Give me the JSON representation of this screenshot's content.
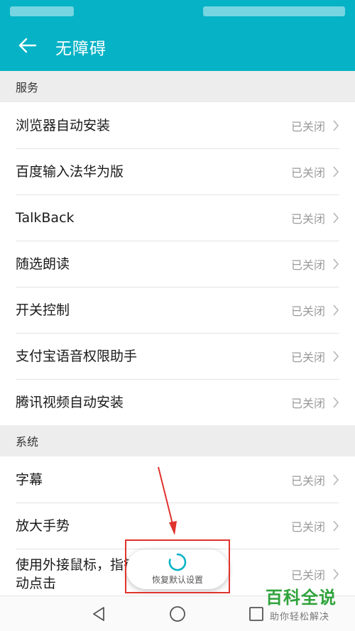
{
  "colors": {
    "accent": "#06b2c6",
    "highlight": "#e0332e",
    "watermark": "#2fa33b"
  },
  "appbar": {
    "title": "无障碍",
    "back_icon": "arrow-left-icon"
  },
  "sections": [
    {
      "header": "服务",
      "items": [
        {
          "label": "浏览器自动安装",
          "value": "已关闭"
        },
        {
          "label": "百度输入法华为版",
          "value": "已关闭"
        },
        {
          "label": "TalkBack",
          "value": "已关闭"
        },
        {
          "label": "随选朗读",
          "value": "已关闭"
        },
        {
          "label": "开关控制",
          "value": "已关闭"
        },
        {
          "label": "支付宝语音权限助手",
          "value": "已关闭"
        },
        {
          "label": "腾讯视频自动安装",
          "value": "已关闭"
        }
      ]
    },
    {
      "header": "系统",
      "items": [
        {
          "label": "字幕",
          "value": "已关闭"
        },
        {
          "label": "放大手势",
          "value": "已关闭"
        },
        {
          "label": "使用外接鼠标，指针停止移动后自动点击",
          "label_line1": "使用外接鼠标，指针停止移动后自",
          "label_line2": "动点击",
          "value": "已关闭"
        }
      ]
    }
  ],
  "toast": {
    "text": "恢复默认设置",
    "icon": "loading-spinner-icon"
  },
  "navbar": {
    "back": "triangle-back-icon",
    "home": "circle-home-icon",
    "recents": "square-recents-icon"
  },
  "watermark": {
    "title": "百科全说",
    "subtitle": "助你轻松解决"
  }
}
